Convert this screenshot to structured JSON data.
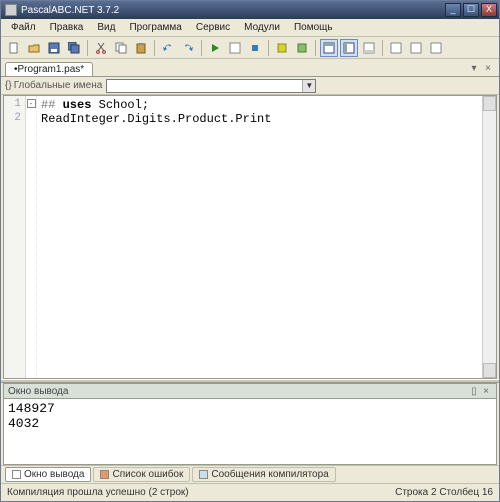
{
  "window": {
    "title": "PascalABC.NET 3.7.2",
    "btn_min": "_",
    "btn_max": "☐",
    "btn_close": "X"
  },
  "menu": {
    "file": "Файл",
    "edit": "Правка",
    "view": "Вид",
    "program": "Программа",
    "service": "Сервис",
    "modules": "Модули",
    "help": "Помощь"
  },
  "toolbar": {
    "new": "new",
    "open": "open",
    "save": "save",
    "saveall": "saveall",
    "cut": "cut",
    "copy": "copy",
    "paste": "paste",
    "undo": "undo",
    "redo": "redo",
    "run": "run",
    "stop": "stop",
    "step": "step",
    "compile": "compile",
    "build": "build",
    "view1": "view1",
    "view2": "view2",
    "view3": "view3",
    "tool1": "tool1",
    "tool2": "tool2",
    "tool3": "tool3"
  },
  "tabs": {
    "file1": "•Program1.pas*",
    "close": "×",
    "dd": "▾"
  },
  "combo": {
    "label": "Глобальные имена",
    "dd": "▼"
  },
  "code": {
    "ln1": "1",
    "ln2": "2",
    "line1_pre": "## ",
    "line1_kw": "uses",
    "line1_rest": " School;",
    "line2": "ReadInteger.Digits.Product.Print",
    "fold": "-"
  },
  "output_panel": {
    "title": "Окно вывода",
    "pin": "▯",
    "close": "×",
    "lines": "148927\n4032"
  },
  "bottom_tabs": {
    "out": "Окно вывода",
    "err": "Список ошибок",
    "msg": "Сообщения компилятора"
  },
  "status": {
    "left": "Компиляция прошла успешно (2 строк)",
    "right": "Строка  2  Столбец  16"
  }
}
